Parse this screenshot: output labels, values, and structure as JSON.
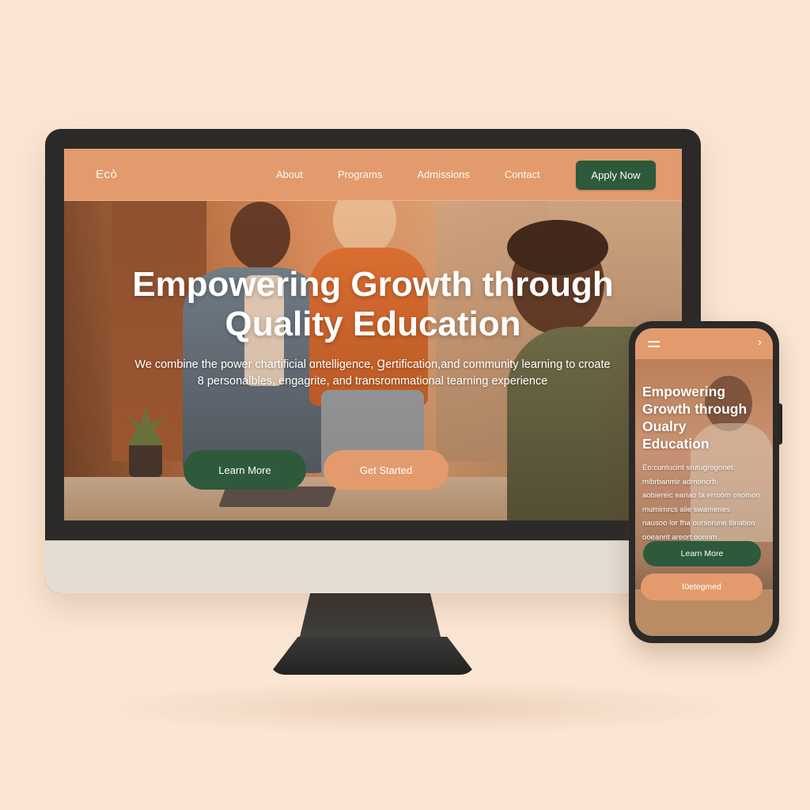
{
  "desktop": {
    "nav": {
      "logo": "Ecò",
      "links": [
        "About",
        "Programs",
        "Admissions",
        "Contact"
      ],
      "apply_label": "Apply Now"
    },
    "hero": {
      "title_lines": [
        "Empowering Growth through",
        "Quality Education"
      ],
      "subtitle_lines": [
        "We combine the power chartificial ɑntelligence, Ɡertification,and community learning to croate",
        "8 personalbles, engagrite, and transrommational tearning experience"
      ],
      "learn_more_label": "Learn More",
      "get_started_label": "Get Started"
    }
  },
  "mobile": {
    "nav": {
      "chevron": "›"
    },
    "hero": {
      "title_lines": [
        "Empowering",
        "Growth through",
        "Oualry",
        "Education"
      ],
      "body_lines": [
        "Eo:cuntucint srutugrogonet",
        "mibrbanmir admoncrb,",
        "aobiereic eariao ta erroom osomon",
        "mumirnrcs alie swamenes",
        "nausoo lor fha oursorune tlination",
        "ooeanrit areort oonnm"
      ],
      "learn_more_label": "Learn More",
      "get_started_label": "Ⅰ0etegmed"
    }
  },
  "colors": {
    "background": "#fbe6d3",
    "accent_orange": "#e39b6d",
    "accent_green": "#2c5a3b"
  }
}
